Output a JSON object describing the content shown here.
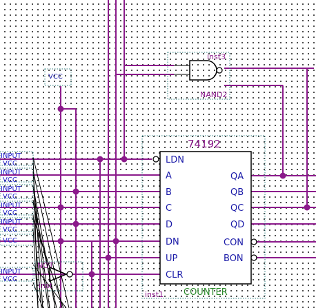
{
  "counter": {
    "part": "74192",
    "instance": "inst1",
    "function_title": "COUNTER",
    "left_pins": [
      "LDN",
      "A",
      "B",
      "C",
      "D",
      "DN",
      "UP",
      "CLR"
    ],
    "right_pins": [
      "QA",
      "QB",
      "QC",
      "QD",
      "CON",
      "BON"
    ]
  },
  "nand_gate": {
    "instance": "inst3",
    "type": "NAND2"
  },
  "not_gate": {
    "type": "NOT",
    "instance": "inst"
  },
  "power": {
    "vcc_label": "VCC"
  },
  "inputs": {
    "labels": [
      "INPUT",
      "INPUT",
      "INPUT",
      "INPUT",
      "INPUT",
      "INPUT",
      "INPUT"
    ],
    "sublabel": "VCC"
  },
  "colors": {
    "wire": "#8b1a8b",
    "pin_label": "#1a1aa8",
    "title": "#2a8a2a",
    "dashed_border": "#2f7f7f"
  }
}
